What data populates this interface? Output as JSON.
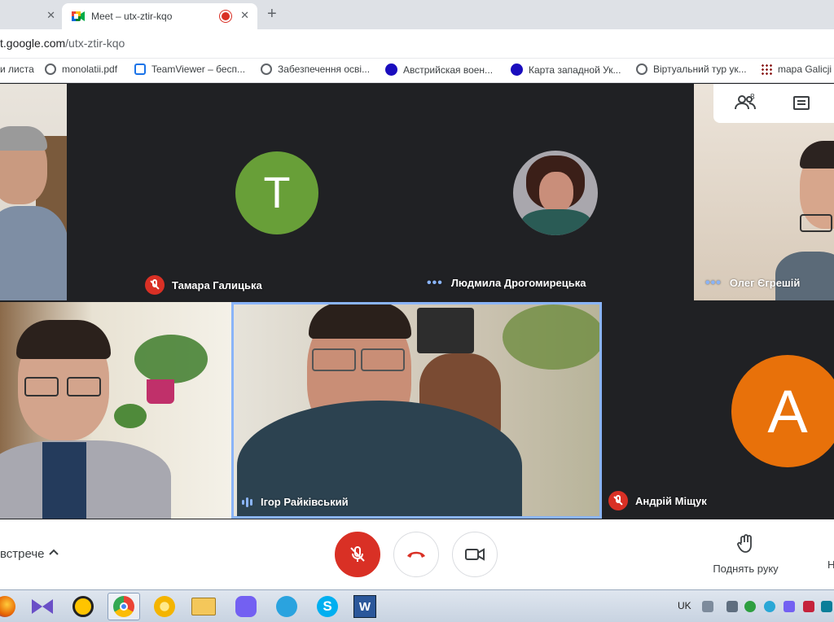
{
  "browser": {
    "tabs": [
      {
        "label": "",
        "has_close": true
      },
      {
        "label": "Meet – utx-ztir-kqo",
        "recording": true
      }
    ],
    "url_host": "t.google.com",
    "url_path": "/utx-ztir-kqo",
    "bookmarks": [
      {
        "label": "и листа",
        "icon": "none"
      },
      {
        "label": "monolatii.pdf",
        "icon": "globe-icon"
      },
      {
        "label": "TeamViewer – бесп...",
        "icon": "teamviewer-icon"
      },
      {
        "label": "Забезпечення осві...",
        "icon": "globe-icon"
      },
      {
        "label": "Австрийская воен...",
        "icon": "blue-circle-icon"
      },
      {
        "label": "Карта западной Ук...",
        "icon": "blue-circle-icon"
      },
      {
        "label": "Віртуальний тур ук...",
        "icon": "globe-icon"
      },
      {
        "label": "mapa Galicji",
        "icon": "grid-icon"
      }
    ]
  },
  "meet": {
    "participant_count": "8",
    "participants": [
      {
        "name": "Тамара Галицька",
        "status": "muted",
        "avatar_letter": "T",
        "avatar_color": "#689f38"
      },
      {
        "name": "Людмила Дрогомирецька",
        "status": "idle"
      },
      {
        "name": "Олег Єгрешій",
        "status": "idle"
      },
      {
        "name": "Ігор Райківський",
        "status": "speaking"
      },
      {
        "name": "Андрій Міщук",
        "status": "muted",
        "avatar_letter": "A",
        "avatar_color": "#e8710a"
      }
    ],
    "meeting_details_label": "встрече",
    "raise_hand_label": "Поднять руку",
    "present_label_cut": "Н"
  },
  "taskbar": {
    "language": "UK",
    "apps": [
      "firefox-icon",
      "visual-studio-icon",
      "archicad-icon",
      "chrome-icon",
      "chrome-canary-icon",
      "explorer-icon",
      "viber-icon",
      "telegram-icon",
      "skype-icon",
      "word-icon"
    ]
  },
  "colors": {
    "mute_red": "#d93025",
    "accent_blue": "#8ab4f8"
  }
}
